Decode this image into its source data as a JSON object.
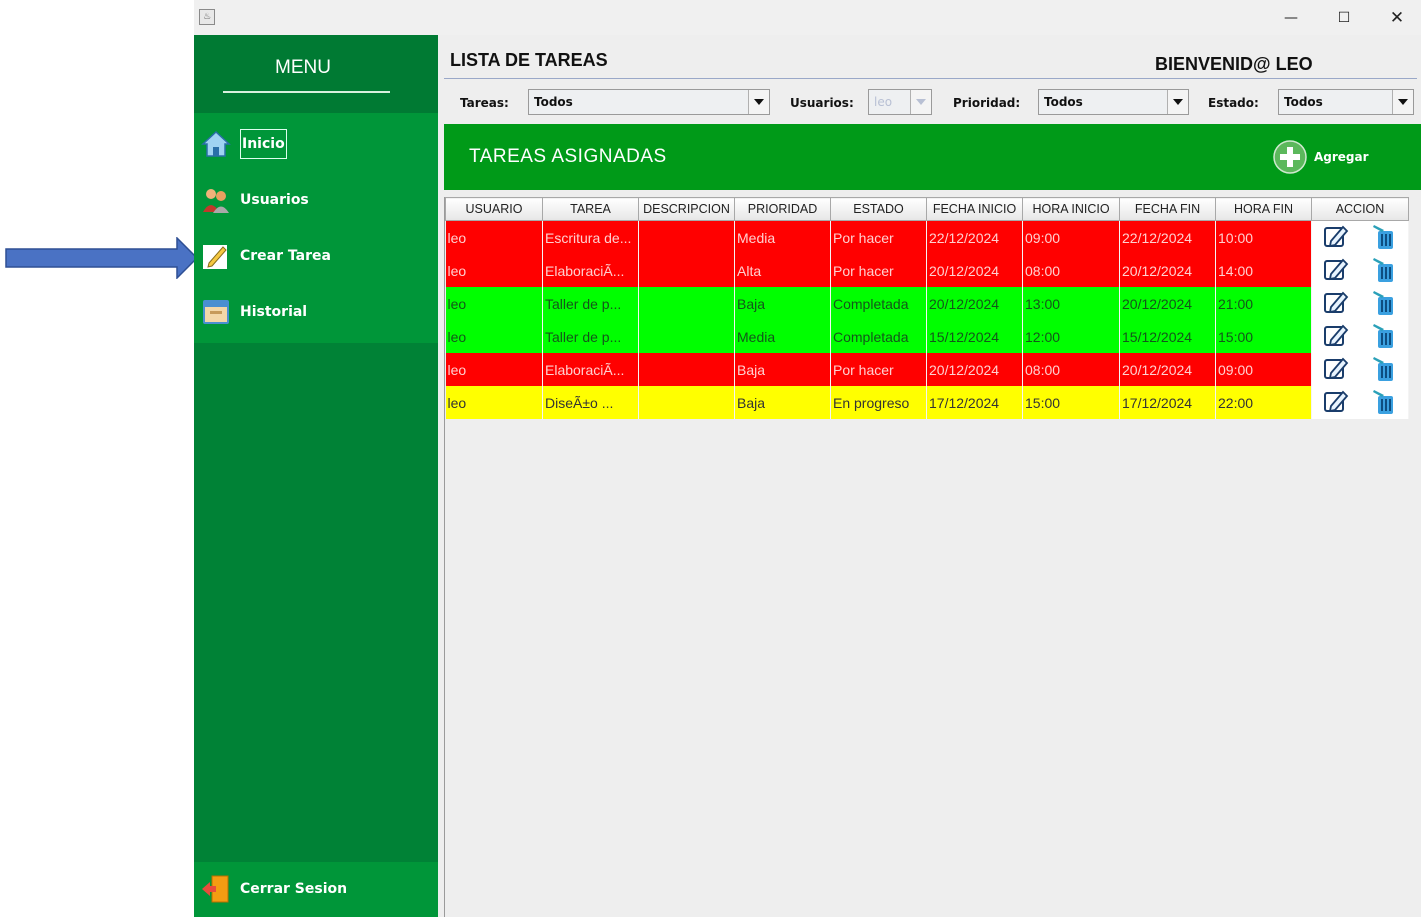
{
  "sidebar": {
    "title": "MENU",
    "items": [
      {
        "label": "Inicio",
        "icon": "home-icon"
      },
      {
        "label": "Usuarios",
        "icon": "users-icon"
      },
      {
        "label": "Crear Tarea",
        "icon": "pencil-icon"
      },
      {
        "label": "Historial",
        "icon": "archive-icon"
      }
    ],
    "logout_label": "Cerrar Sesion"
  },
  "header": {
    "title": "LISTA DE TAREAS",
    "welcome": "BIENVENID@ LEO"
  },
  "filters": {
    "tareas_label": "Tareas:",
    "tareas_value": "Todos",
    "usuarios_label": "Usuarios:",
    "usuarios_value": "leo",
    "prioridad_label": "Prioridad:",
    "prioridad_value": "Todos",
    "estado_label": "Estado:",
    "estado_value": "Todos"
  },
  "banner": {
    "title": "TAREAS ASIGNADAS",
    "add_label": "Agregar"
  },
  "table": {
    "columns": [
      "USUARIO",
      "TAREA",
      "DESCRIPCION",
      "PRIORIDAD",
      "ESTADO",
      "FECHA INICIO",
      "HORA INICIO",
      "FECHA FIN",
      "HORA FIN",
      "ACCION"
    ],
    "rows": [
      {
        "color": "red",
        "cells": [
          "leo",
          "Escritura de...",
          "",
          "Media",
          "Por hacer",
          "22/12/2024",
          "09:00",
          "22/12/2024",
          "10:00"
        ]
      },
      {
        "color": "red",
        "cells": [
          "leo",
          "ElaboraciÃ...",
          "",
          "Alta",
          "Por hacer",
          "20/12/2024",
          "08:00",
          "20/12/2024",
          "14:00"
        ]
      },
      {
        "color": "green",
        "cells": [
          "leo",
          "Taller de p...",
          "",
          "Baja",
          "Completada",
          "20/12/2024",
          "13:00",
          "20/12/2024",
          "21:00"
        ]
      },
      {
        "color": "green",
        "cells": [
          "leo",
          "Taller de p...",
          "",
          "Media",
          "Completada",
          "15/12/2024",
          "12:00",
          "15/12/2024",
          "15:00"
        ]
      },
      {
        "color": "red",
        "cells": [
          "leo",
          "ElaboraciÃ...",
          "",
          "Baja",
          "Por hacer",
          "20/12/2024",
          "08:00",
          "20/12/2024",
          "09:00"
        ]
      },
      {
        "color": "yellow",
        "cells": [
          "leo",
          "DiseÃ±o ...",
          "",
          "Baja",
          "En progreso",
          "17/12/2024",
          "15:00",
          "17/12/2024",
          "22:00"
        ]
      }
    ]
  },
  "colors": {
    "sidebar": "#008236",
    "banner": "#009a18",
    "row_red": "#ff0000",
    "row_green": "#00ff00",
    "row_yellow": "#ffff00"
  }
}
